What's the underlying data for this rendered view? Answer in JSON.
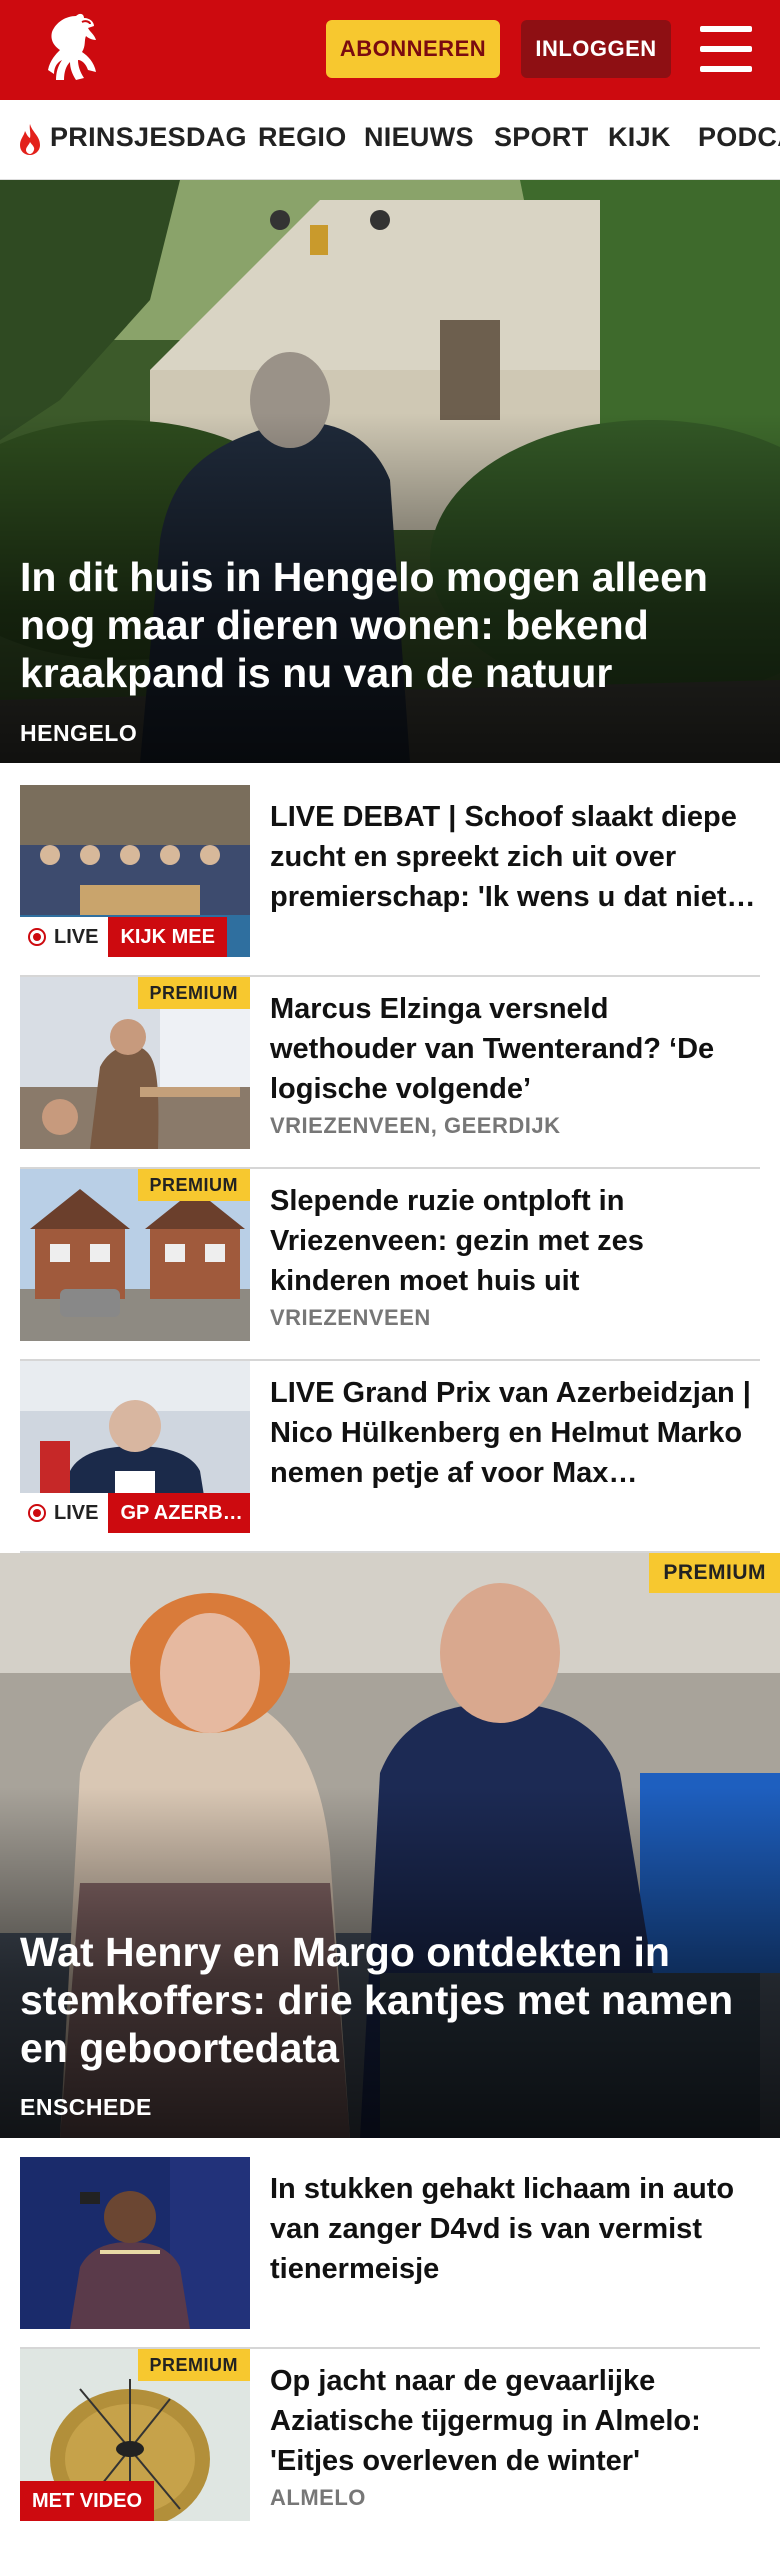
{
  "header": {
    "logo_icon": "horse-icon",
    "subscribe_label": "ABONNEREN",
    "login_label": "INLOGGEN",
    "menu_icon": "hamburger-icon",
    "colors": {
      "brand_red": "#cd0a0f",
      "subscribe_yellow": "#f7c82f",
      "login_dark_red": "#8e0f13"
    }
  },
  "nav": {
    "items": [
      {
        "label": "PRINSJESDAG",
        "icon": "flame-icon"
      },
      {
        "label": "REGIO"
      },
      {
        "label": "NIEUWS"
      },
      {
        "label": "SPORT"
      },
      {
        "label": "KIJK"
      },
      {
        "label": "PODCAST"
      }
    ]
  },
  "hero1": {
    "title": "In dit huis in Hengelo mogen alleen nog maar dieren wonen: bekend kraakpand is nu van de natuur",
    "location": "HENGELO"
  },
  "articles1": [
    {
      "title": "LIVE DEBAT | Schoof slaakt diepe zucht en spreekt zich uit over premierschap: 'Ik wens u dat niet toe'",
      "live_label": "LIVE",
      "tag": "KIJK MEE"
    },
    {
      "title": "Marcus Elzinga versneld wethouder van Twenterand? ‘De logische volgende’",
      "badge": "PREMIUM",
      "location": "VRIEZENVEEN, GEERDIJK"
    },
    {
      "title": "Slepende ruzie ontploft in Vriezenveen: gezin met zes kinderen moet huis uit",
      "badge": "PREMIUM",
      "location": "VRIEZENVEEN"
    },
    {
      "title": "LIVE Grand Prix van Azerbeidzjan | Nico Hülkenberg en Helmut Marko nemen petje af voor Max Verstappen",
      "live_label": "LIVE",
      "tag": "GP AZERBEIDZJAN"
    }
  ],
  "hero2": {
    "badge": "PREMIUM",
    "title": "Wat Henry en Margo ontdekten in stemkoffers: drie kantjes met namen en geboortedata",
    "location": "ENSCHEDE"
  },
  "articles2": [
    {
      "title": "In stukken gehakt lichaam in auto van zanger D4vd is van vermist tienermeisje"
    },
    {
      "title": "Op jacht naar de gevaarlijke Aziatische tijgermug in Almelo: 'Eitjes overleven de winter'",
      "badge": "PREMIUM",
      "location": "ALMELO",
      "tag": "MET VIDEO"
    }
  ]
}
